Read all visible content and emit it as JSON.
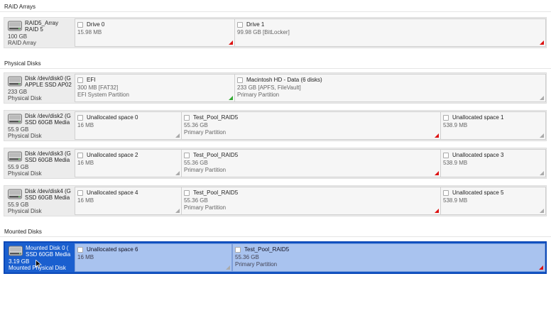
{
  "sections": {
    "raid": {
      "title": "RAID Arrays",
      "disk": {
        "name1": "RAID5_Array",
        "name2": "RAID 5",
        "size": "100 GB",
        "type": "RAID Array",
        "icon": "disk-drive-icon"
      },
      "partitions": [
        {
          "name": "Drive 0",
          "size": "15.98 MB",
          "type": "",
          "corner": "red"
        },
        {
          "name": "Drive 1",
          "size": "99.98 GB [BitLocker]",
          "type": "",
          "corner": "red"
        }
      ]
    },
    "physical": {
      "title": "Physical Disks",
      "disks": [
        {
          "name1": "Disk /dev/disk0 (G",
          "name2": "APPLE SSD AP02",
          "size": "233 GB",
          "type": "Physical Disk",
          "partitions": [
            {
              "name": "EFI",
              "size": "300 MB [FAT32]",
              "type": "EFI System Partition",
              "corner": "green"
            },
            {
              "name": "Macintosh HD - Data (6 disks)",
              "size": "233 GB [APFS, FileVault]",
              "type": "Primary Partition",
              "corner": "gray"
            }
          ]
        },
        {
          "name1": "Disk /dev/disk2 (G",
          "name2": "SSD 60GB Media",
          "size": "55.9 GB",
          "type": "Physical Disk",
          "partitions": [
            {
              "name": "Unallocated space 0",
              "size": "16 MB",
              "type": "",
              "corner": "gray"
            },
            {
              "name": "Test_Pool_RAID5",
              "size": "55.36 GB",
              "type": "Primary Partition",
              "corner": "red"
            },
            {
              "name": "Unallocated space 1",
              "size": "538.9 MB",
              "type": "",
              "corner": "gray"
            }
          ]
        },
        {
          "name1": "Disk /dev/disk3 (G",
          "name2": "SSD 60GB Media",
          "size": "55.9 GB",
          "type": "Physical Disk",
          "partitions": [
            {
              "name": "Unallocated space 2",
              "size": "16 MB",
              "type": "",
              "corner": "gray"
            },
            {
              "name": "Test_Pool_RAID5",
              "size": "55.36 GB",
              "type": "Primary Partition",
              "corner": "red"
            },
            {
              "name": "Unallocated space 3",
              "size": "538.9 MB",
              "type": "",
              "corner": "gray"
            }
          ]
        },
        {
          "name1": "Disk /dev/disk4 (G",
          "name2": "SSD 60GB Media",
          "size": "55.9 GB",
          "type": "Physical Disk",
          "partitions": [
            {
              "name": "Unallocated space 4",
              "size": "16 MB",
              "type": "",
              "corner": "gray"
            },
            {
              "name": "Test_Pool_RAID5",
              "size": "55.36 GB",
              "type": "Primary Partition",
              "corner": "red"
            },
            {
              "name": "Unallocated space 5",
              "size": "538.9 MB",
              "type": "",
              "corner": "gray"
            }
          ]
        }
      ]
    },
    "mounted": {
      "title": "Mounted Disks",
      "disk": {
        "name1": "Mounted Disk 0 (",
        "name2": "SSD 60GB Media",
        "size": "3.19 GB",
        "type": "Mounted Physical Disk"
      },
      "partitions": [
        {
          "name": "Unallocated space 6",
          "size": "16 MB",
          "type": "",
          "corner": "gray"
        },
        {
          "name": "Test_Pool_RAID5",
          "size": "55.36 GB",
          "type": "Primary Partition",
          "corner": "red"
        }
      ]
    }
  },
  "colors": {
    "selection": "#1a5fcf",
    "selected_partition": "#a9c3ef",
    "warning": "#d11",
    "ok": "#3a3"
  }
}
